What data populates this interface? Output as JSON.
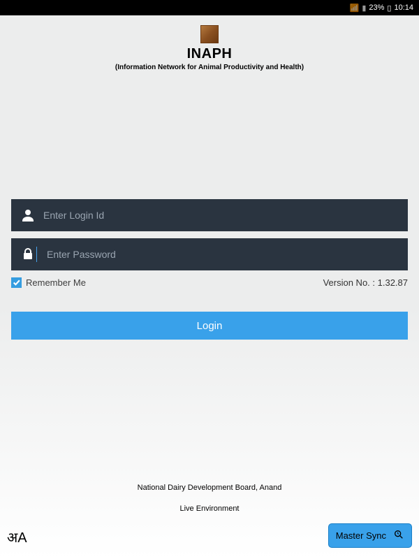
{
  "status": {
    "signal": "📶",
    "battery_pct": "23%",
    "battery_icon": "▯",
    "time": "10:14"
  },
  "header": {
    "title": "INAPH",
    "subtitle": "(Information Network for Animal Productivity and Health)"
  },
  "form": {
    "login_placeholder": "Enter Login Id",
    "password_placeholder": "Enter Password",
    "remember_label": "Remember Me",
    "remember_checked": true,
    "version_label": "Version No. : 1.32.87",
    "login_button": "Login"
  },
  "footer": {
    "org": "National Dairy Development Board, Anand",
    "env": "Live Environment"
  },
  "bottom": {
    "lang_glyph": "अA",
    "sync_label": "Master Sync"
  }
}
